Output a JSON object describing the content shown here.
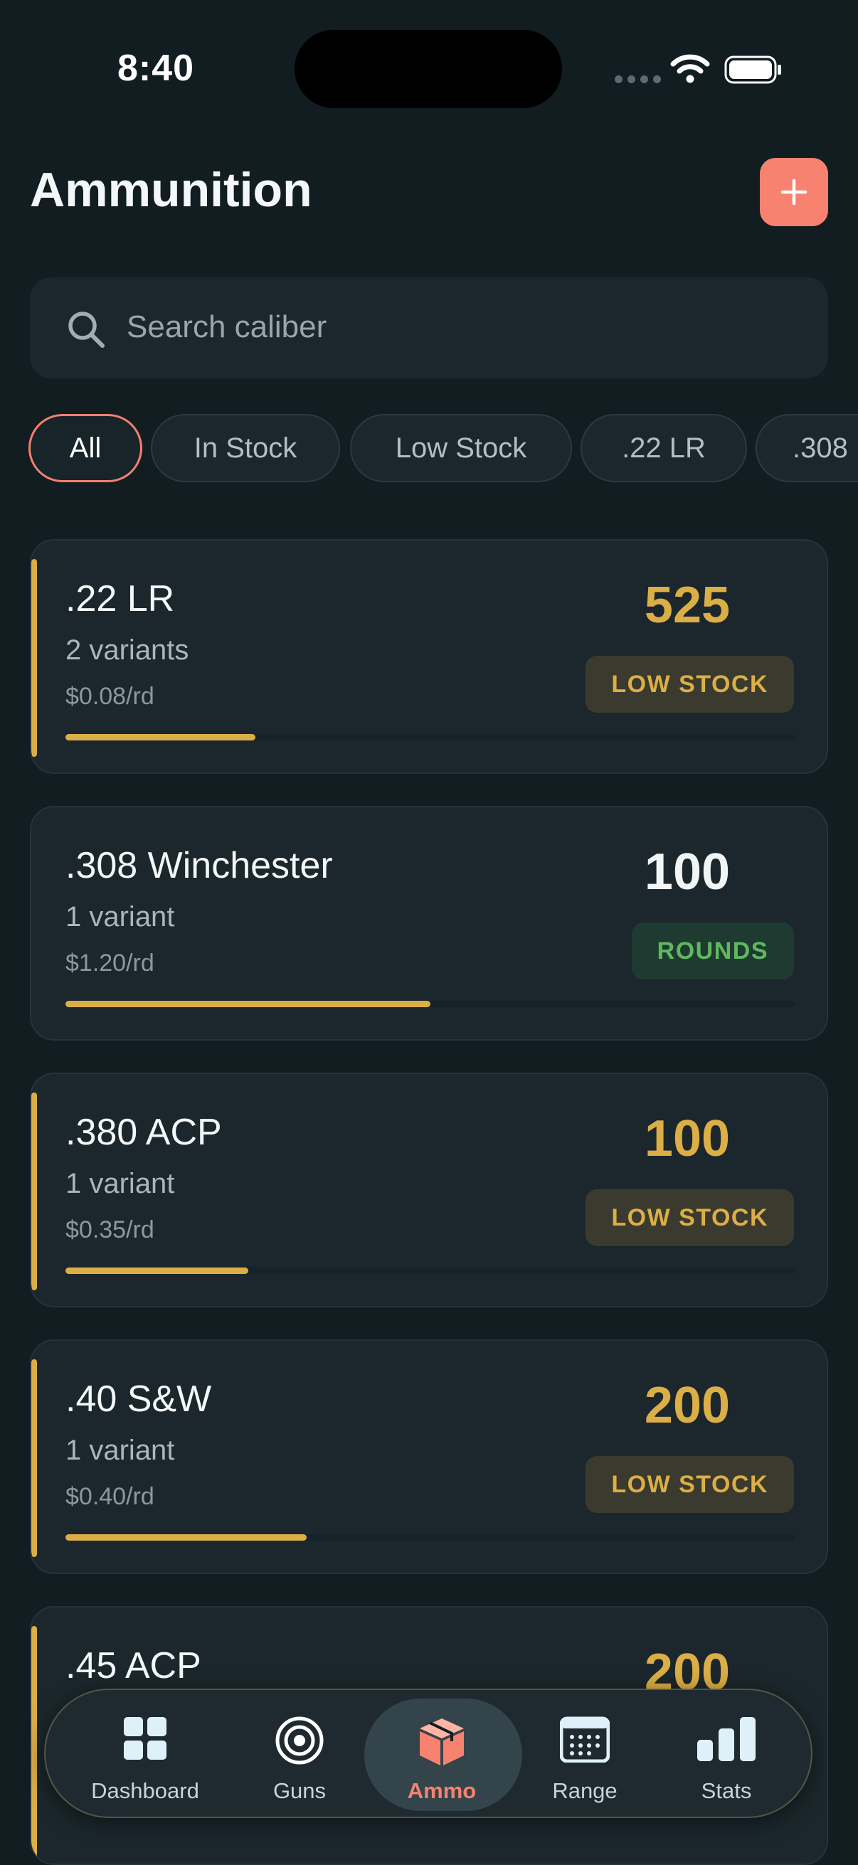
{
  "status_bar": {
    "time": "8:40"
  },
  "header": {
    "title": "Ammunition"
  },
  "search": {
    "placeholder": "Search caliber"
  },
  "filters": [
    {
      "label": "All",
      "active": true
    },
    {
      "label": "In Stock",
      "active": false
    },
    {
      "label": "Low Stock",
      "active": false
    },
    {
      "label": ".22 LR",
      "active": false
    },
    {
      "label": ".308",
      "active": false
    }
  ],
  "ammo": [
    {
      "caliber": ".22 LR",
      "variants": "2 variants",
      "price": "$0.08/rd",
      "count": "525",
      "badge": "LOW STOCK",
      "status": "low",
      "level": 0.26
    },
    {
      "caliber": ".308 Winchester",
      "variants": "1 variant",
      "price": "$1.20/rd",
      "count": "100",
      "badge": "ROUNDS",
      "status": "ok",
      "level": 0.5
    },
    {
      "caliber": ".380 ACP",
      "variants": "1 variant",
      "price": "$0.35/rd",
      "count": "100",
      "badge": "LOW STOCK",
      "status": "low",
      "level": 0.25
    },
    {
      "caliber": ".40 S&W",
      "variants": "1 variant",
      "price": "$0.40/rd",
      "count": "200",
      "badge": "LOW STOCK",
      "status": "low",
      "level": 0.33
    },
    {
      "caliber": ".45 ACP",
      "variants": "",
      "price": "",
      "count": "200",
      "badge": "",
      "status": "low",
      "level": 0.3
    }
  ],
  "tabs": [
    {
      "label": "Dashboard",
      "icon": "dashboard-grid-icon",
      "active": false
    },
    {
      "label": "Guns",
      "icon": "target-icon",
      "active": false
    },
    {
      "label": "Ammo",
      "icon": "ammo-box-icon",
      "active": true
    },
    {
      "label": "Range",
      "icon": "calendar-icon",
      "active": false
    },
    {
      "label": "Stats",
      "icon": "bar-chart-icon",
      "active": false
    }
  ],
  "colors": {
    "accent": "#f6826f",
    "low": "#dcae46",
    "ok": "#5fb860",
    "background": "#121d21",
    "card": "#1b272c"
  }
}
